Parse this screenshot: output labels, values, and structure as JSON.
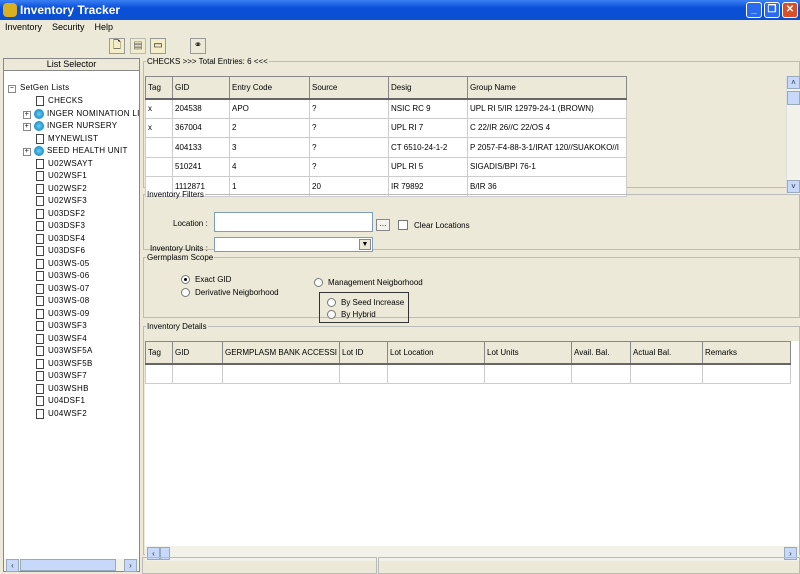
{
  "window": {
    "title": "Inventory Tracker"
  },
  "menu": [
    "Inventory",
    "Security",
    "Help"
  ],
  "toolbar": [
    {
      "icon": "new-document-icon"
    },
    {
      "icon": "save-document-icon"
    },
    {
      "icon": "open-folder-icon"
    },
    {
      "icon": "binoculars-icon"
    }
  ],
  "list_selector": {
    "title": "List Selector",
    "root": "SetGen Lists",
    "items": [
      {
        "label": "CHECKS",
        "type": "doc"
      },
      {
        "label": "INGER NOMINATION LI",
        "type": "group"
      },
      {
        "label": "INGER NURSERY",
        "type": "group"
      },
      {
        "label": "MYNEWLIST",
        "type": "doc"
      },
      {
        "label": "SEED HEALTH UNIT",
        "type": "group"
      },
      {
        "label": "U02WSAYT",
        "type": "doc"
      },
      {
        "label": "U02WSF1",
        "type": "doc"
      },
      {
        "label": "U02WSF2",
        "type": "doc"
      },
      {
        "label": "U02WSF3",
        "type": "doc"
      },
      {
        "label": "U03DSF2",
        "type": "doc"
      },
      {
        "label": "U03DSF3",
        "type": "doc"
      },
      {
        "label": "U03DSF4",
        "type": "doc"
      },
      {
        "label": "U03DSF6",
        "type": "doc"
      },
      {
        "label": "U03WS-05",
        "type": "doc"
      },
      {
        "label": "U03WS-06",
        "type": "doc"
      },
      {
        "label": "U03WS-07",
        "type": "doc"
      },
      {
        "label": "U03WS-08",
        "type": "doc"
      },
      {
        "label": "U03WS-09",
        "type": "doc"
      },
      {
        "label": "U03WSF3",
        "type": "doc"
      },
      {
        "label": "U03WSF4",
        "type": "doc"
      },
      {
        "label": "U03WSF5A",
        "type": "doc"
      },
      {
        "label": "U03WSF5B",
        "type": "doc"
      },
      {
        "label": "U03WSF7",
        "type": "doc"
      },
      {
        "label": "U03WSHB",
        "type": "doc"
      },
      {
        "label": "U04DSF1",
        "type": "doc"
      },
      {
        "label": "U04WSF2",
        "type": "doc"
      }
    ]
  },
  "checks": {
    "legend": "CHECKS >>> Total Entries: 6 <<<",
    "columns": [
      "Tag",
      "GID",
      "Entry Code",
      "Source",
      "Desig",
      "Group Name"
    ],
    "rows": [
      [
        "x",
        "204538",
        "APO",
        "?",
        "NSIC RC 9",
        "UPL RI 5/IR 12979-24-1 (BROWN)"
      ],
      [
        "x",
        "367004",
        "2",
        "?",
        "UPL RI 7",
        "C 22/IR 26//C 22/OS 4"
      ],
      [
        "",
        "404133",
        "3",
        "?",
        "CT 6510-24-1-2",
        "P 2057-F4-88-3-1/IRAT 120//SUAKOKO//I"
      ],
      [
        "",
        "510241",
        "4",
        "?",
        "UPL RI 5",
        "SIGADIS/BPI 76-1"
      ],
      [
        "",
        "1112871",
        "1",
        "20",
        "IR 79892",
        "B/IR 36"
      ]
    ]
  },
  "filters": {
    "legend": "Inventory Filters",
    "location_label": "Location :",
    "location_value": "",
    "browse_label": "...",
    "clear_label": "Clear Locations",
    "clear_checked": false,
    "units_label": "Inventory Units :",
    "units_value": ""
  },
  "scope": {
    "legend": "Germplasm Scope",
    "exact": "Exact GID",
    "derivative": "Derivative Neigborhood",
    "management": "Management Neigborhood",
    "seed_increase": "By Seed Increase",
    "hybrid": "By Hybrid",
    "selected": "exact"
  },
  "details": {
    "legend": "Inventory Details",
    "columns": [
      "Tag",
      "GID",
      "GERMPLASM BANK ACCESSI",
      "Lot ID",
      "Lot Location",
      "Lot Units",
      "Avail. Bal.",
      "Actual Bal.",
      "Remarks"
    ]
  }
}
